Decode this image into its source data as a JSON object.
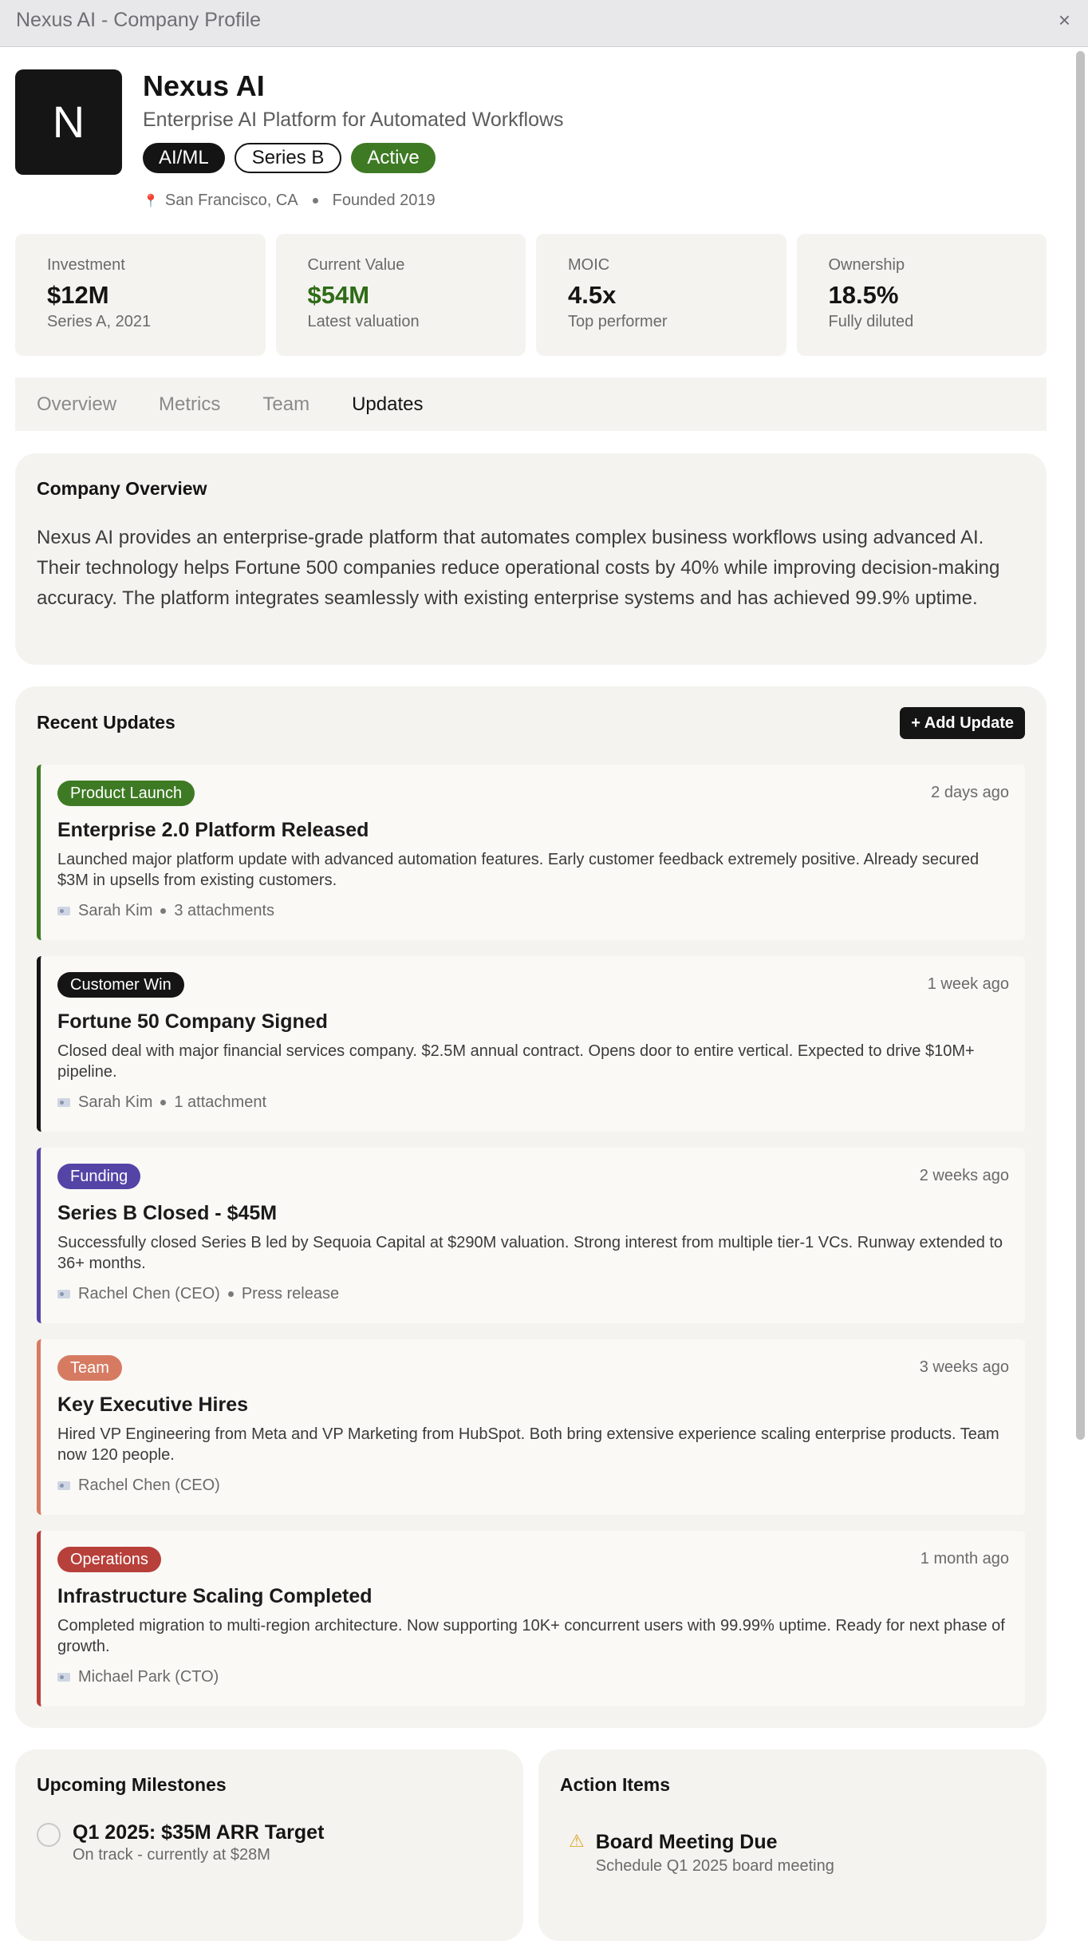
{
  "window": {
    "title": "Nexus AI - Company Profile",
    "close_symbol": "×"
  },
  "company": {
    "logo_letter": "N",
    "name": "Nexus AI",
    "tagline": "Enterprise AI Platform for Automated Workflows",
    "tags": [
      "AI/ML",
      "Series B",
      "Active"
    ],
    "location": "San Francisco, CA",
    "founded": "Founded 2019"
  },
  "stats": [
    {
      "label": "Investment",
      "value": "$12M",
      "sub": "Series A, 2021"
    },
    {
      "label": "Current Value",
      "value": "$54M",
      "sub": "Latest valuation"
    },
    {
      "label": "MOIC",
      "value": "4.5x",
      "sub": "Top performer"
    },
    {
      "label": "Ownership",
      "value": "18.5%",
      "sub": "Fully diluted"
    }
  ],
  "tabs": [
    "Overview",
    "Metrics",
    "Team",
    "Updates"
  ],
  "active_tab": "Updates",
  "overview": {
    "title": "Company Overview",
    "body": "Nexus AI provides an enterprise-grade platform that automates complex business workflows using advanced AI. Their technology helps Fortune 500 companies reduce operational costs by 40% while improving decision-making accuracy. The platform integrates seamlessly with existing enterprise systems and has achieved 99.9% uptime."
  },
  "updates": {
    "title": "Recent Updates",
    "add_label": "+ Add Update",
    "items": [
      {
        "badge": "Product Launch",
        "color": "#3e7a24",
        "time": "2 days ago",
        "title": "Enterprise 2.0 Platform Released",
        "body": "Launched major platform update with advanced automation features. Early customer feedback extremely positive. Already secured $3M in upsells from existing customers.",
        "author": "Sarah Kim",
        "extra": "3 attachments"
      },
      {
        "badge": "Customer Win",
        "color": "#151515",
        "time": "1 week ago",
        "title": "Fortune 50 Company Signed",
        "body": "Closed deal with major financial services company. $2.5M annual contract. Opens door to entire vertical. Expected to drive $10M+ pipeline.",
        "author": "Sarah Kim",
        "extra": "1 attachment"
      },
      {
        "badge": "Funding",
        "color": "#5444a6",
        "time": "2 weeks ago",
        "title": "Series B Closed - $45M",
        "body": "Successfully closed Series B led by Sequoia Capital at $290M valuation. Strong interest from multiple tier-1 VCs. Runway extended to 36+ months.",
        "author": "Rachel Chen (CEO)",
        "extra": "Press release"
      },
      {
        "badge": "Team",
        "color": "#d67b62",
        "time": "3 weeks ago",
        "title": "Key Executive Hires",
        "body": "Hired VP Engineering from Meta and VP Marketing from HubSpot. Both bring extensive experience scaling enterprise products. Team now 120 people.",
        "author": "Rachel Chen (CEO)",
        "extra": ""
      },
      {
        "badge": "Operations",
        "color": "#b8403a",
        "time": "1 month ago",
        "title": "Infrastructure Scaling Completed",
        "body": "Completed migration to multi-region architecture. Now supporting 10K+ concurrent users with 99.99% uptime. Ready for next phase of growth.",
        "author": "Michael Park (CTO)",
        "extra": ""
      }
    ]
  },
  "milestones": {
    "title": "Upcoming Milestones",
    "items": [
      {
        "title": "Q1 2025: $35M ARR Target",
        "sub": "On track - currently at $28M"
      }
    ]
  },
  "actions": {
    "title": "Action Items",
    "items": [
      {
        "title": "Board Meeting Due",
        "sub": "Schedule Q1 2025 board meeting"
      }
    ]
  },
  "icons": {
    "close": "close-icon",
    "pin": "map-pin-icon",
    "author": "user-card-icon",
    "warning": "warning-icon"
  }
}
